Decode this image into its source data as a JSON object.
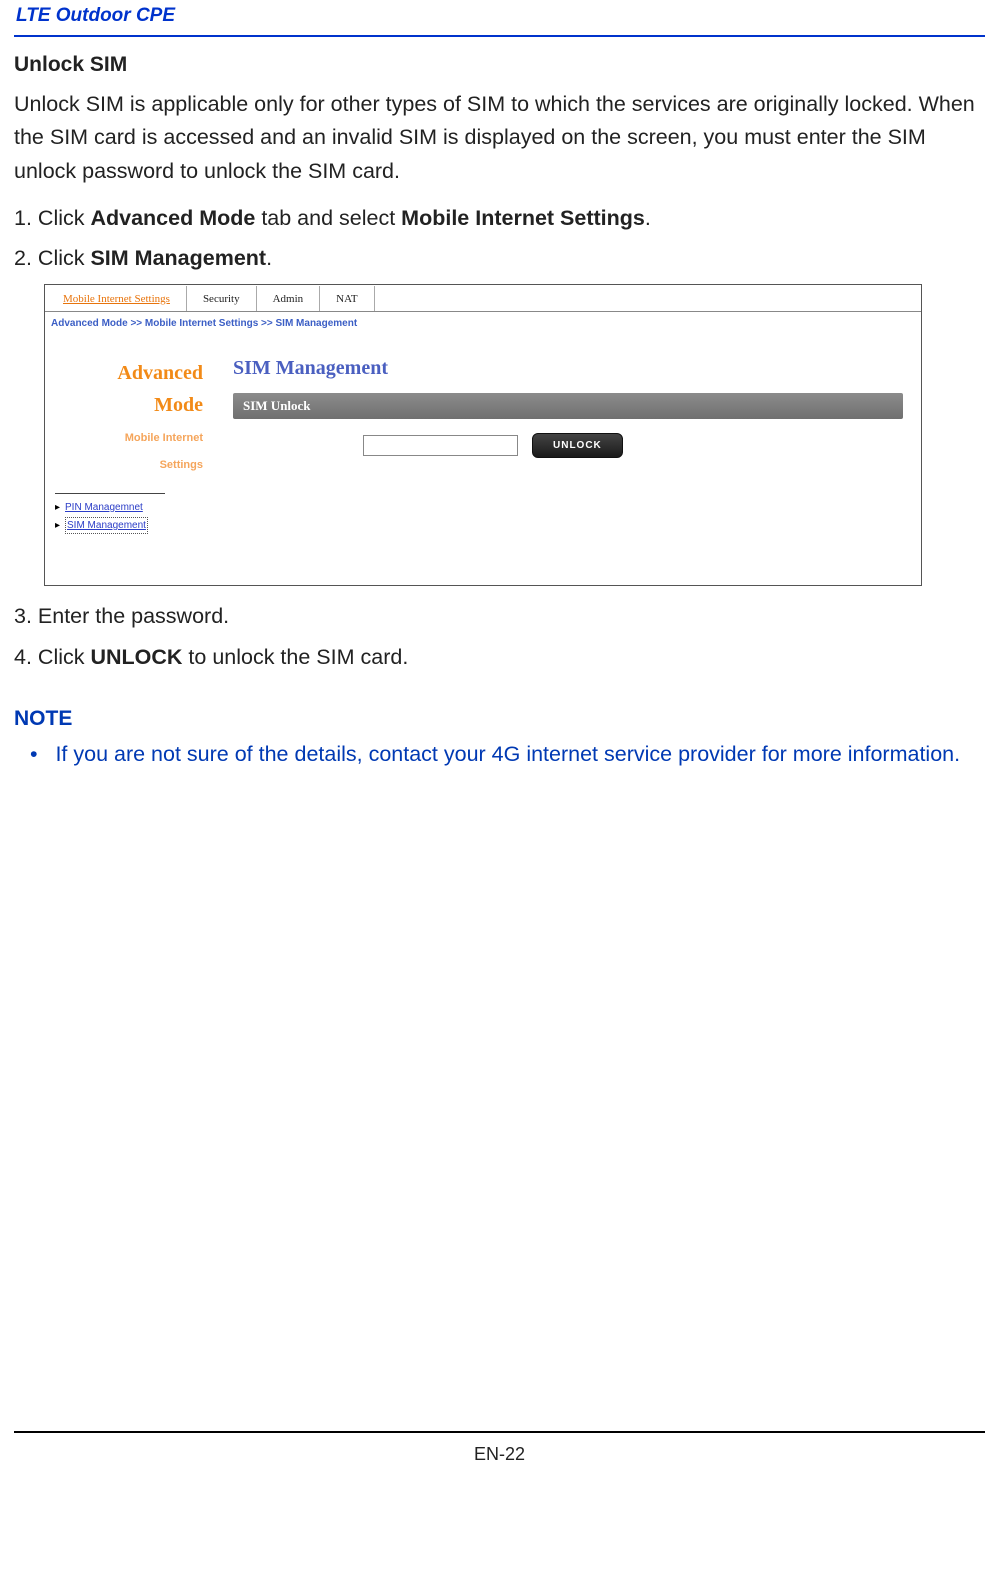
{
  "doc": {
    "header_title": "LTE Outdoor CPE",
    "section_heading": "Unlock SIM",
    "intro_paragraph": "Unlock SIM is applicable only for other types of SIM to which the services are originally locked. When the SIM card is accessed and an invalid SIM is displayed on the screen, you must enter the SIM unlock password to unlock the SIM card.",
    "steps": {
      "s1_prefix": "1.",
      "s1_pre": " Click ",
      "s1_bold1": "Advanced Mode",
      "s1_mid": " tab and select ",
      "s1_bold2": "Mobile Internet Settings",
      "s1_suffix": ".",
      "s2_prefix": "2.",
      "s2_pre": " Click ",
      "s2_bold": "SIM Management",
      "s2_suffix": ".",
      "s3_prefix": "3.",
      "s3_text": " Enter the password.",
      "s4_prefix": "4.",
      "s4_pre": " Click ",
      "s4_bold": "UNLOCK",
      "s4_suffix": " to unlock the SIM card."
    },
    "note_heading": "NOTE",
    "note_bullet_marker": "•",
    "note_text": "If you are not sure of the details, contact your 4G internet service provider for more information.",
    "page_number": "EN-22"
  },
  "screenshot": {
    "tabs": {
      "active": "Mobile Internet Settings",
      "t2": "Security",
      "t3": "Admin",
      "t4": "NAT"
    },
    "breadcrumb": "Advanced Mode >> Mobile Internet Settings >> SIM Management",
    "sidebar": {
      "line1": "Advanced",
      "line2": "Mode",
      "sub1": "Mobile Internet",
      "sub2": "Settings",
      "link1": "PIN Managemnet",
      "link2": "SIM Management"
    },
    "content": {
      "title": "SIM Management",
      "panel_label": "SIM Unlock",
      "button_label": "UNLOCK"
    }
  }
}
